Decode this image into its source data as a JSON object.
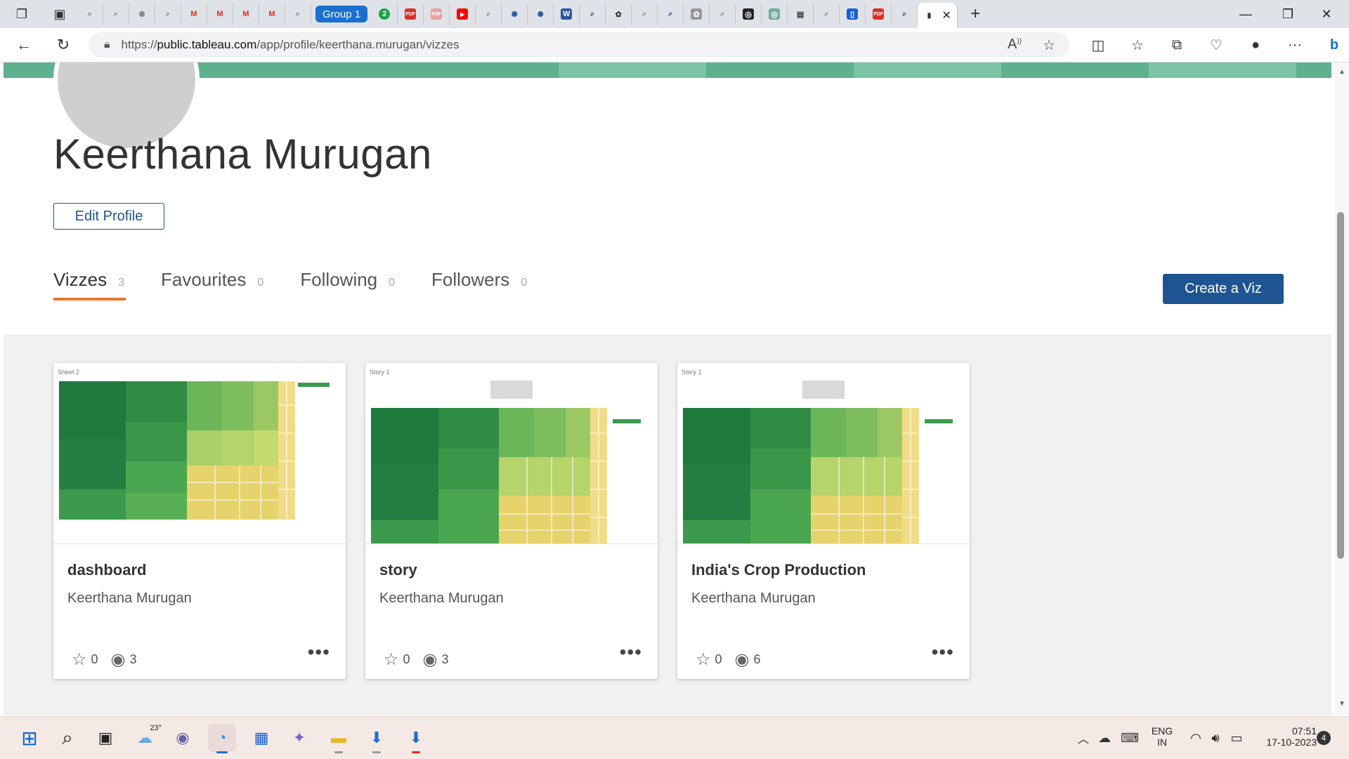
{
  "browser": {
    "group_label": "Group 1",
    "url_prefix": "https://",
    "url_host": "public.tableau.com",
    "url_path": "/app/profile/keerthana.murugan/vizzes"
  },
  "profile": {
    "name": "Keerthana Murugan",
    "edit_label": "Edit Profile",
    "create_label": "Create a Viz",
    "tabs": [
      {
        "label": "Vizzes",
        "count": "3"
      },
      {
        "label": "Favourites",
        "count": "0"
      },
      {
        "label": "Following",
        "count": "0"
      },
      {
        "label": "Followers",
        "count": "0"
      }
    ]
  },
  "cards": [
    {
      "title": "dashboard",
      "author": "Keerthana Murugan",
      "favs": "0",
      "views": "3",
      "sheet": "Sheet 2",
      "more": "•••"
    },
    {
      "title": "story",
      "author": "Keerthana Murugan",
      "favs": "0",
      "views": "3",
      "sheet": "Story 1",
      "more": "•••"
    },
    {
      "title": "India's Crop Production",
      "author": "Keerthana Murugan",
      "favs": "0",
      "views": "6",
      "sheet": "Story 1",
      "more": "•••"
    }
  ],
  "taskbar": {
    "weather": "23°",
    "lang_1": "ENG",
    "lang_2": "IN",
    "time": "07:51",
    "date": "17-10-2023",
    "notifications": "4"
  },
  "colors": {
    "accent": "#1f5493",
    "tab_underline": "#e8762c",
    "banner": "#5eb18f"
  }
}
